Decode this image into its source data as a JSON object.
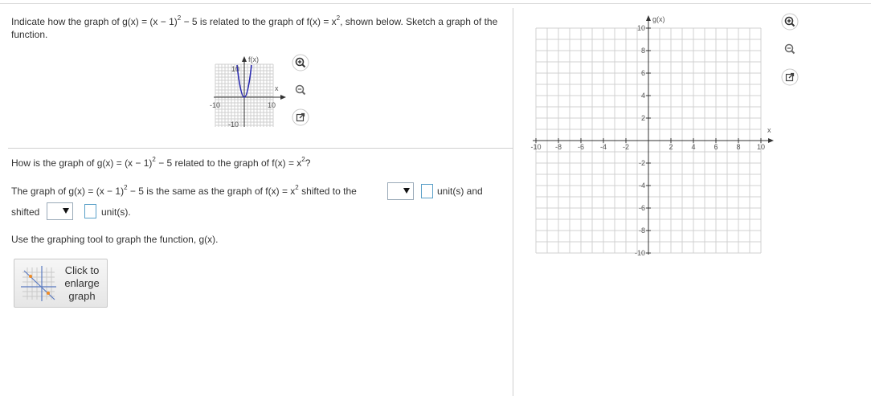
{
  "question": {
    "p1": "Indicate how the graph of g(x) = (x − 1)",
    "p1_exp": "2",
    "p2": " − 5 is related to the graph of f(x) = x",
    "p2_exp": "2",
    "p3": ", shown below. Sketch a graph of the function."
  },
  "prompt": {
    "a": "How is the graph of g(x) = (x − 1)",
    "a_exp": "2",
    "b": " − 5 related to the graph of f(x) = x",
    "b_exp": "2",
    "c": "?"
  },
  "sentence": {
    "a": "The graph of g(x) = (x − 1)",
    "a_exp": "2",
    "b": " − 5 is the same as the graph of f(x) = x",
    "b_exp": "2",
    "c": " shifted to the",
    "units_and": "unit(s) and",
    "shifted": "shifted",
    "units_end": "unit(s)."
  },
  "instruction": "Use the graphing tool to graph the function, g(x).",
  "enlarge_button": "Click to enlarge graph",
  "small_graph": {
    "ylabel": "f(x)",
    "xlabel": "x",
    "tick_y_top": "10",
    "tick_y_bottom": "-10",
    "tick_x_left": "-10",
    "tick_x_right": "10"
  },
  "big_graph": {
    "ylabel": "g(x)",
    "xlabel": "x",
    "x_ticks": [
      "-10",
      "-8",
      "-6",
      "-4",
      "-2",
      "2",
      "4",
      "6",
      "8",
      "10"
    ],
    "y_ticks": [
      "10",
      "8",
      "6",
      "4",
      "2",
      "-2",
      "-4",
      "-6",
      "-8",
      "-10"
    ]
  },
  "colors": {
    "accent": "#2a7ab8",
    "curve": "#2b2bb0",
    "grid": "#d0d0d0"
  }
}
